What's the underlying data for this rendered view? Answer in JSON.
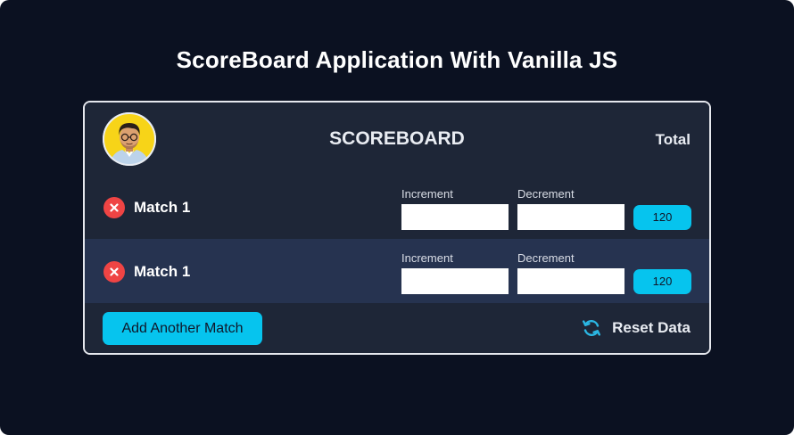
{
  "page": {
    "title": "ScoreBoard Application With Vanilla JS"
  },
  "board": {
    "title": "SCOREBOARD",
    "total_label": "Total",
    "avatar_icon": "developer-avatar"
  },
  "matches": [
    {
      "name": "Match 1",
      "increment_label": "Increment",
      "increment_value": "",
      "decrement_label": "Decrement",
      "decrement_value": "",
      "total": "120",
      "delete_icon": "close-circle-icon"
    },
    {
      "name": "Match 1",
      "increment_label": "Increment",
      "increment_value": "",
      "decrement_label": "Decrement",
      "decrement_value": "",
      "total": "120",
      "delete_icon": "close-circle-icon"
    }
  ],
  "footer": {
    "add_match_label": "Add Another Match",
    "reset_label": "Reset Data",
    "reset_icon": "refresh-icon"
  },
  "colors": {
    "page_bg": "#0b1121",
    "board_bg": "#1e2637",
    "alt_row_bg": "#263350",
    "accent": "#06c4ee",
    "delete_red": "#ef4444"
  }
}
